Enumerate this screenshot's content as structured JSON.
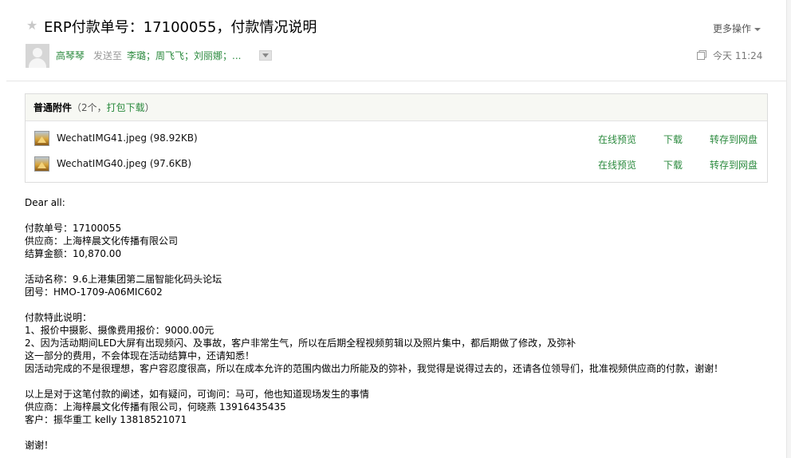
{
  "header": {
    "star": "★",
    "title": "ERP付款单号：17100055，付款情况说明",
    "more_ops": "更多操作",
    "sender": "高琴琴",
    "sendto_label": "发送至",
    "recipients": "李璐；周飞飞；刘丽娜；...",
    "time": "今天 11:24"
  },
  "attachments": {
    "label": "普通附件",
    "count": "（2个，",
    "download_all": "打包下载",
    "count_close": "）",
    "files": [
      {
        "name": "WechatIMG41.jpeg (98.92KB)",
        "preview": "在线预览",
        "download": "下载",
        "save": "转存到网盘"
      },
      {
        "name": "WechatIMG40.jpeg (97.6KB)",
        "preview": "在线预览",
        "download": "下载",
        "save": "转存到网盘"
      }
    ]
  },
  "body": {
    "greeting": "Dear all:",
    "payment_no": "付款单号：17100055",
    "supplier": "供应商：上海梓晨文化传播有限公司",
    "amount": "结算金额：10,870.00",
    "activity": "活动名称：9.6上港集团第二届智能化码头论坛",
    "group_no": "团号：HMO-1709-A06MIC602",
    "special_title": "付款特此说明：",
    "special_1": "1、报价中摄影、摄像费用报价：9000.00元",
    "special_2": "2、因为活动期间LED大屏有出现频闪、及事故，客户非常生气，所以在后期全程视频剪辑以及照片集中，都后期做了修改，及弥补",
    "special_3": "这一部分的费用，不会体现在活动结算中，还请知悉！",
    "special_4": "因活动完成的不是很理想，客户容忍度很高，所以在成本允许的范围内做出力所能及的弥补，我觉得是说得过去的，还请各位领导们，批准视频供应商的付款，谢谢！",
    "closing_1": "以上是对于这笔付款的阐述，如有疑问，可询问：马可，他也知道现场发生的事情",
    "closing_2": "供应商：上海梓晨文化传播有限公司，何晓燕 13916435435",
    "closing_3": "客户：振华重工 kelly 13818521071",
    "thanks": "谢谢！"
  }
}
